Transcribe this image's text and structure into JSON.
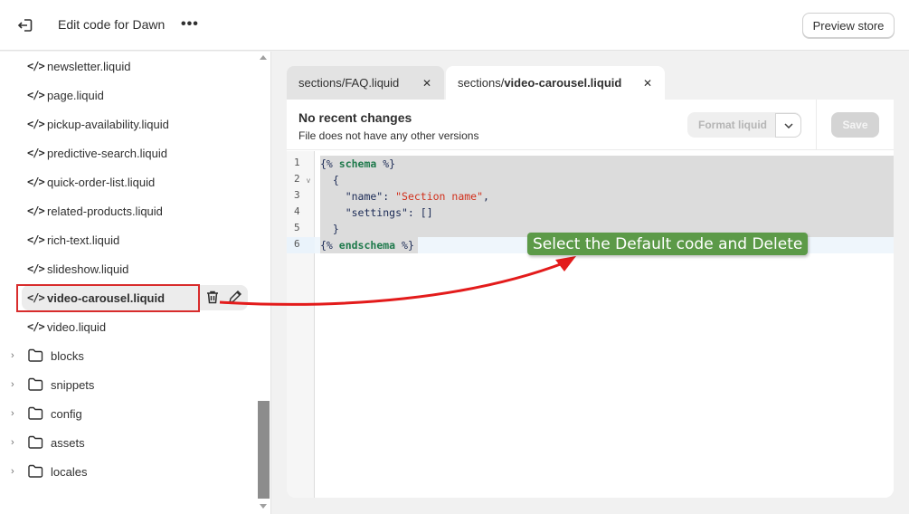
{
  "header": {
    "title": "Edit code for Dawn",
    "more_label": "•••",
    "preview_button": "Preview store"
  },
  "sidebar": {
    "files": [
      {
        "name": "newsletter.liquid"
      },
      {
        "name": "page.liquid"
      },
      {
        "name": "pickup-availability.liquid"
      },
      {
        "name": "predictive-search.liquid"
      },
      {
        "name": "quick-order-list.liquid"
      },
      {
        "name": "related-products.liquid"
      },
      {
        "name": "rich-text.liquid"
      },
      {
        "name": "slideshow.liquid"
      },
      {
        "name": "video-carousel.liquid",
        "selected": true
      },
      {
        "name": "video.liquid"
      }
    ],
    "folders": [
      {
        "name": "blocks"
      },
      {
        "name": "snippets"
      },
      {
        "name": "config"
      },
      {
        "name": "assets"
      },
      {
        "name": "locales"
      }
    ],
    "code_icon_glyph": "</>",
    "folder_chevron": "›"
  },
  "tabs": [
    {
      "prefix": "sections/",
      "name": "FAQ.liquid",
      "active": false,
      "close": "✕"
    },
    {
      "prefix": "sections/",
      "name": "video-carousel.liquid",
      "active": true,
      "close": "✕"
    }
  ],
  "editor": {
    "status_title": "No recent changes",
    "status_subtitle": "File does not have any other versions",
    "format_button": "Format liquid",
    "format_chevron": "⌄",
    "save_button": "Save",
    "line_numbers": [
      "1",
      "2",
      "3",
      "4",
      "5",
      "6"
    ],
    "fold_marker": "v",
    "code": {
      "l1_open": "{% ",
      "l1_kw": "schema",
      "l1_close": " %}",
      "l2": "  {",
      "l3_key": "    \"name\": ",
      "l3_val": "\"Section name\"",
      "l3_end": ",",
      "l4": "    \"settings\": []",
      "l5": "  }",
      "l6_open": "{% ",
      "l6_kw": "endschema",
      "l6_close": " %}"
    }
  },
  "annotation": {
    "text": "Select the Default code and Delete",
    "color": "#5c9a48",
    "arrow_color": "#e31b1b"
  }
}
